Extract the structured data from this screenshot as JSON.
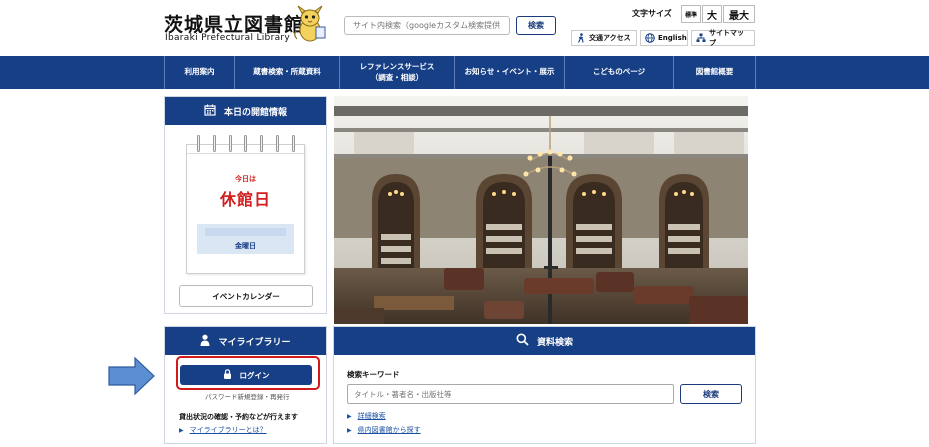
{
  "header": {
    "logo_jp": "茨城県立図書館",
    "logo_en": "Ibaraki Prefectural Library",
    "search_placeholder": "サイト内検索（googleカスタム検索提供",
    "search_button": "検索",
    "font_size_label": "文字サイズ",
    "font_size_standard": "標準",
    "font_size_large": "大",
    "font_size_max": "最大",
    "access_label": "交通アクセス",
    "english_label": "English",
    "sitemap_label": "サイトマップ"
  },
  "nav": {
    "items": [
      {
        "label": "利用案内"
      },
      {
        "label": "蔵書検索・所蔵資料"
      },
      {
        "label": "レファレンスサービス",
        "sub": "（調査・相談）"
      },
      {
        "label": "お知らせ・イベント・展示"
      },
      {
        "label": "こどものページ"
      },
      {
        "label": "図書館概要"
      }
    ]
  },
  "opening": {
    "title": "本日の開館情報",
    "today_label": "今日は",
    "status": "休館日",
    "weekday": "金曜日",
    "event_calendar_button": "イベントカレンダー"
  },
  "mylibrary": {
    "title": "マイライブラリー",
    "login_button": "ログイン",
    "password_text": "パスワード新規登録・再発行",
    "description": "貸出状況の確認・予約などが行えます",
    "about_link": "マイライブラリーとは？"
  },
  "search": {
    "title": "資料検索",
    "keyword_label": "検索キーワード",
    "keyword_placeholder": "タイトル・著者名・出版社等",
    "search_button": "検索",
    "advanced_link": "詳細検索",
    "prefecture_link": "県内図書館から探す"
  },
  "colors": {
    "primary_navy": "#173f86",
    "closed_red": "#d41d1d",
    "highlight_red": "#d11a1a",
    "arrow_blue": "#5b8fd1"
  }
}
